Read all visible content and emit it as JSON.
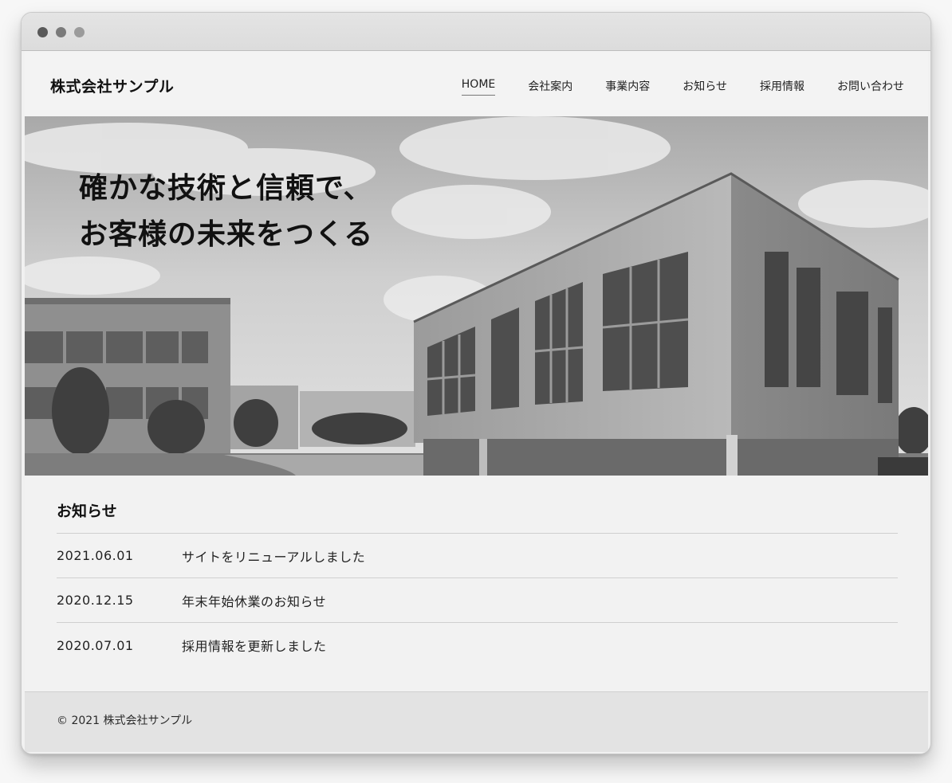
{
  "site": {
    "brand": "株式会社サンプル"
  },
  "nav": {
    "items": [
      "HOME",
      "会社案内",
      "事業内容",
      "お知らせ",
      "採用情報",
      "お問い合わせ"
    ]
  },
  "hero": {
    "line1": "確かな技術と信頼で、",
    "line2": "お客様の未来をつくる"
  },
  "news": {
    "title": "お知らせ",
    "items": [
      {
        "date": "2021.06.01",
        "text": "サイトをリニューアルしました"
      },
      {
        "date": "2020.12.15",
        "text": "年末年始休業のお知らせ"
      },
      {
        "date": "2020.07.01",
        "text": "採用情報を更新しました"
      }
    ]
  },
  "footer": {
    "copyright": "© 2021 株式会社サンプル"
  }
}
